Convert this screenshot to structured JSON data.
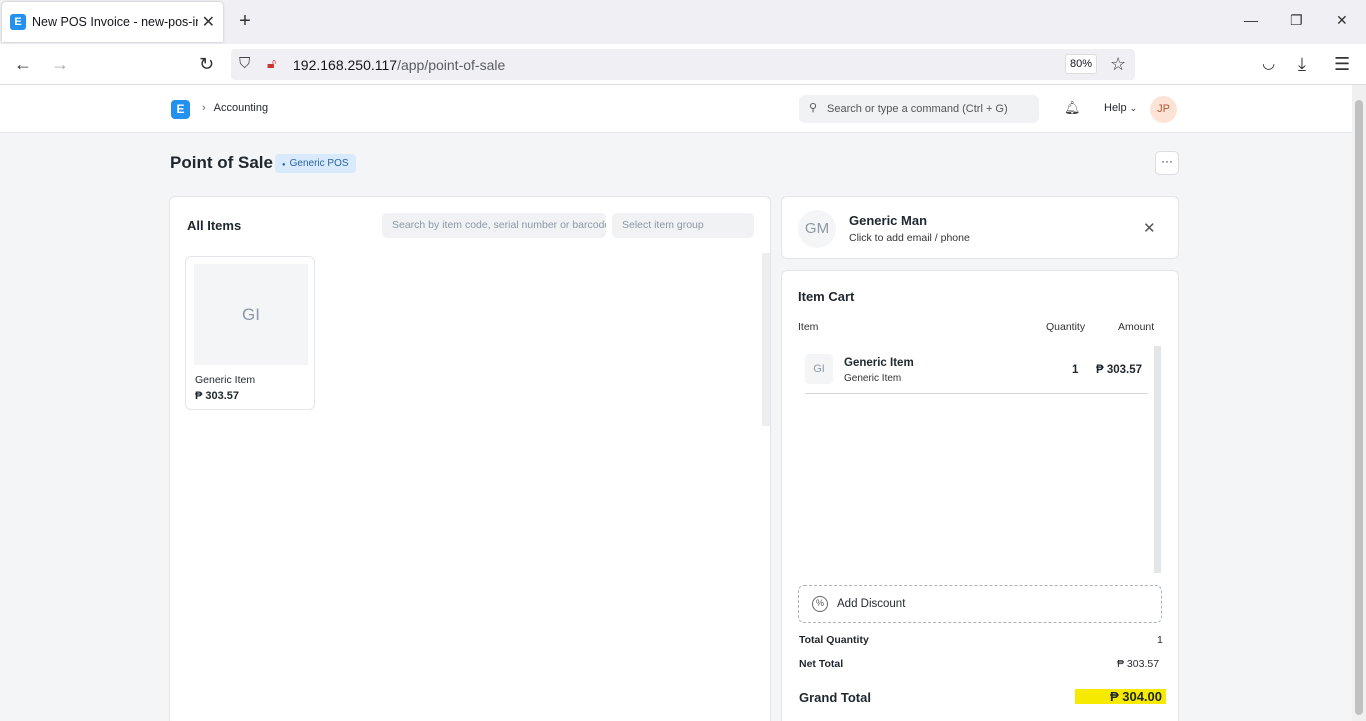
{
  "browser": {
    "tab_title": "New POS Invoice - new-pos-inv",
    "url_host": "192.168.250.117",
    "url_path": "/app/point-of-sale",
    "zoom": "80%"
  },
  "appnav": {
    "breadcrumb": "Accounting",
    "search_placeholder": "Search or type a command (Ctrl + G)",
    "help_label": "Help",
    "user_initials": "JP",
    "logo_letter": "E"
  },
  "page": {
    "title": "Point of Sale",
    "badge": "Generic POS",
    "more": "···"
  },
  "items": {
    "title": "All Items",
    "search_placeholder": "Search by item code, serial number or barcode",
    "group_placeholder": "Select item group",
    "list": [
      {
        "initials": "GI",
        "name": "Generic Item",
        "price": "₱ 303.57"
      }
    ]
  },
  "customer": {
    "initials": "GM",
    "name": "Generic Man",
    "subtitle": "Click to add email / phone"
  },
  "cart": {
    "title": "Item Cart",
    "col_item": "Item",
    "col_qty": "Quantity",
    "col_amount": "Amount",
    "rows": [
      {
        "initials": "GI",
        "name": "Generic Item",
        "sub": "Generic Item",
        "qty": "1",
        "amount": "₱ 303.57"
      }
    ],
    "discount_label": "Add Discount",
    "total_qty_label": "Total Quantity",
    "total_qty": "1",
    "net_total_label": "Net Total",
    "net_total": "₱ 303.57",
    "grand_total_label": "Grand Total",
    "grand_total": "₱ 304.00"
  },
  "colors": {
    "accent": "#2490ef",
    "highlight": "#f6ea00"
  }
}
